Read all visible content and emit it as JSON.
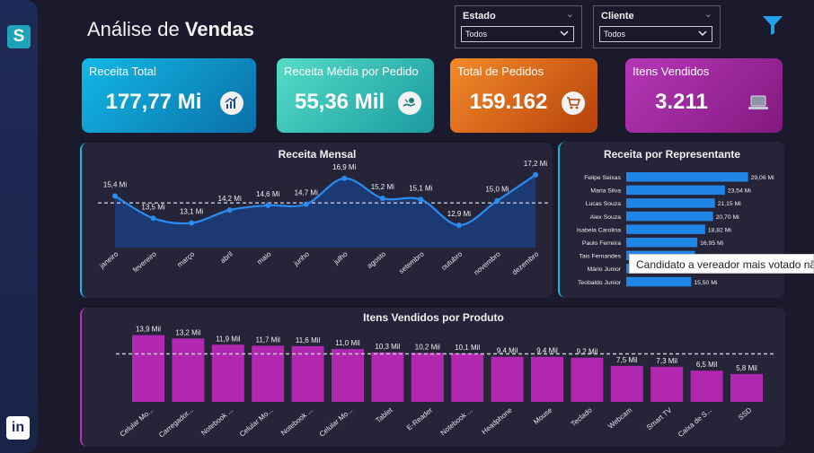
{
  "header": {
    "title_light": "Análise de ",
    "title_bold": "Vendas"
  },
  "slicers": {
    "estado": {
      "label": "Estado",
      "value": "Todos"
    },
    "cliente": {
      "label": "Cliente",
      "value": "Todos"
    }
  },
  "sidebar": {
    "logo_letter": "S",
    "linkedin_label": "in"
  },
  "kpis": [
    {
      "label": "Receita Total",
      "value": "177,77 Mi",
      "icon": "chart-growth-icon"
    },
    {
      "label": "Receita Média por Pedido",
      "value": "55,36 Mil",
      "icon": "hand-money-icon"
    },
    {
      "label": "Total de Pedidos",
      "value": "159.162",
      "icon": "shopping-cart-icon"
    },
    {
      "label": "Itens Vendidos",
      "value": "3.211",
      "icon": "laptop-icon"
    }
  ],
  "colors": {
    "accent_blue": "#1f86e8",
    "accent_purple": "#b127b0",
    "background": "#1b1a2c",
    "panel": "#252438"
  },
  "tooltip": {
    "text": "Candidato a vereador mais votado nã"
  },
  "chart_data": [
    {
      "type": "area",
      "title": "Receita Mensal",
      "categories": [
        "janeiro",
        "fevereiro",
        "março",
        "abril",
        "maio",
        "junho",
        "julho",
        "agosto",
        "setembro",
        "outubro",
        "novembro",
        "dezembro"
      ],
      "values": [
        15.4,
        13.5,
        13.1,
        14.2,
        14.6,
        14.7,
        16.9,
        15.2,
        15.1,
        12.9,
        15.0,
        17.2
      ],
      "labels": [
        "15,4 Mi",
        "13,5 Mi",
        "13,1 Mi",
        "14,2 Mi",
        "14,6 Mi",
        "14,7 Mi",
        "16,9 Mi",
        "15,2 Mi",
        "15,1 Mi",
        "12,9 Mi",
        "15,0 Mi",
        "17,2 Mi"
      ],
      "reference_line": 14.8,
      "ylim": [
        11.0,
        17.5
      ]
    },
    {
      "type": "bar",
      "orientation": "horizontal",
      "title": "Receita por Representante",
      "categories": [
        "Felipe Seixas",
        "Maria Silva",
        "Lucas Souza",
        "Alex Souza",
        "Isabela Carolina",
        "Paulo Ferreira",
        "Tais Fernandes",
        "Mário Junior",
        "Teobaldo Junior"
      ],
      "values": [
        29.06,
        23.54,
        21.15,
        20.7,
        18.82,
        16.95,
        16.4,
        16.0,
        15.5
      ],
      "labels": [
        "29,06 Mi",
        "23,54 Mi",
        "21,15 Mi",
        "20,70 Mi",
        "18,82 Mi",
        "16,95 Mi",
        "",
        "",
        "15,50 Mi"
      ],
      "xlim": [
        0,
        30
      ]
    },
    {
      "type": "bar",
      "title": "Itens Vendidos por Produto",
      "categories": [
        "Celular Mo...",
        "Carregador...",
        "Notebook ...",
        "Celular Mo...",
        "Notebook ...",
        "Celular Mo...",
        "Tablet",
        "E-Reader",
        "Notebook ...",
        "Headphone",
        "Mouse",
        "Teclado",
        "Webcam",
        "Smart TV",
        "Caixa de S...",
        "SSD"
      ],
      "values": [
        13.9,
        13.2,
        11.9,
        11.7,
        11.6,
        11.0,
        10.3,
        10.2,
        10.1,
        9.4,
        9.4,
        9.2,
        7.5,
        7.3,
        6.5,
        5.8
      ],
      "labels": [
        "13,9 Mil",
        "13,2 Mil",
        "11,9 Mil",
        "11,7 Mil",
        "11,6 Mil",
        "11,0 Mil",
        "10,3 Mil",
        "10,2 Mil",
        "10,1 Mil",
        "9,4 Mil",
        "9,4 Mil",
        "9,2 Mil",
        "7,5 Mil",
        "7,3 Mil",
        "6,5 Mil",
        "5,8 Mil"
      ],
      "reference_line": 10.0,
      "ylim": [
        0,
        15.5
      ]
    }
  ]
}
